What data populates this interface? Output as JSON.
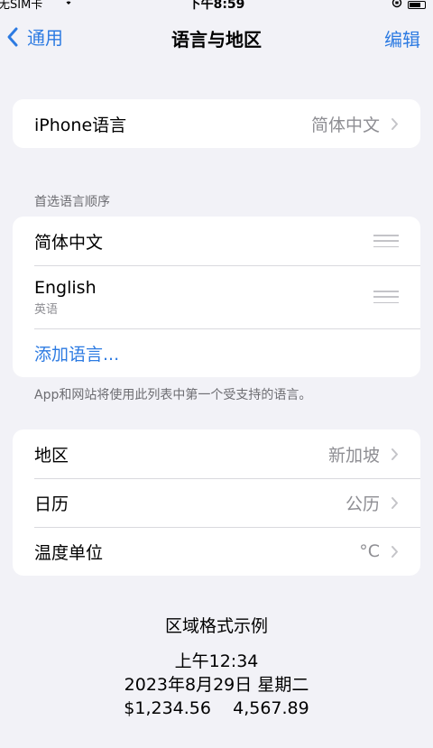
{
  "status_bar": {
    "carrier": "无SIM卡",
    "time": "下午8:59"
  },
  "nav": {
    "back_label": "通用",
    "title": "语言与地区",
    "edit_label": "编辑"
  },
  "iphone_language": {
    "label": "iPhone语言",
    "value": "简体中文"
  },
  "preferred_languages": {
    "header": "首选语言顺序",
    "items": [
      {
        "name": "简体中文",
        "subtitle": ""
      },
      {
        "name": "English",
        "subtitle": "英语"
      }
    ],
    "add_label": "添加语言...",
    "footer": "App和网站将使用此列表中第一个受支持的语言。"
  },
  "region_settings": [
    {
      "label": "地区",
      "value": "新加坡"
    },
    {
      "label": "日历",
      "value": "公历"
    },
    {
      "label": "温度单位",
      "value": "°C"
    }
  ],
  "format_example": {
    "title": "区域格式示例",
    "time": "上午12:34",
    "date": "2023年8月29日 星期二",
    "numbers": "$1,234.56    4,567.89"
  },
  "colors": {
    "accent": "#2d7be2",
    "background": "#f2f2f7",
    "secondary_text": "#8e8e93"
  },
  "icons": {
    "back": "chevron-left-icon",
    "disclosure": "chevron-right-icon",
    "reorder": "reorder-handle-icon",
    "wifi": "wifi-icon",
    "battery": "battery-icon"
  }
}
